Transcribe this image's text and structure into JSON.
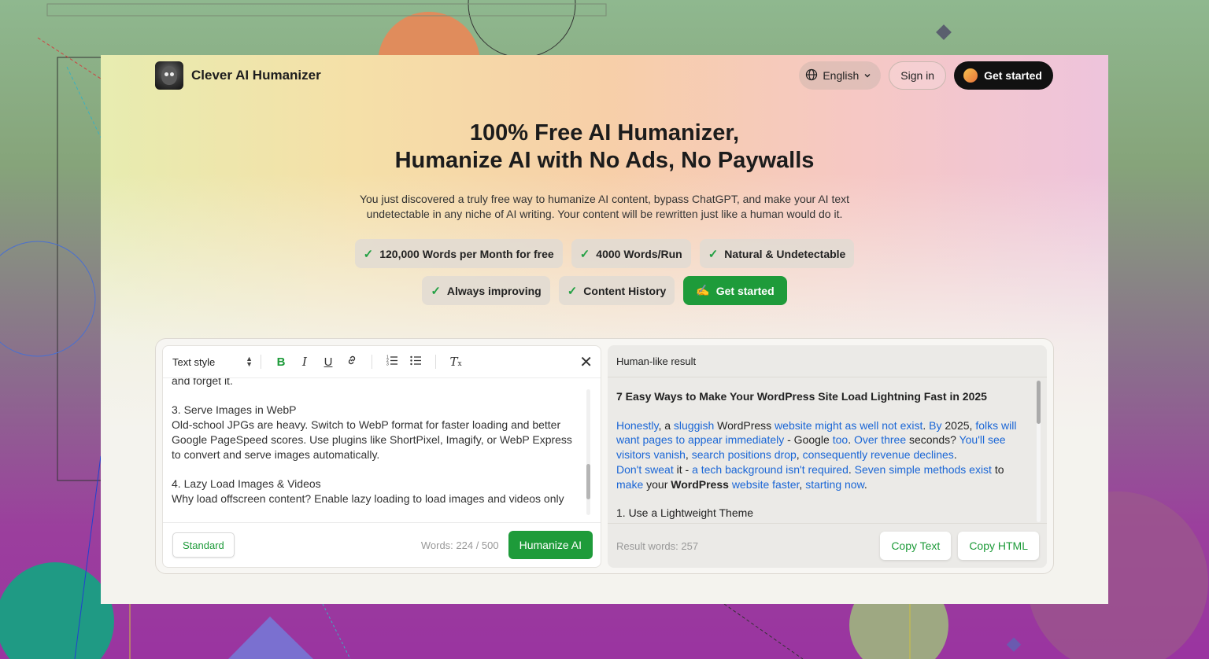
{
  "header": {
    "brand": "Clever AI Humanizer",
    "language": "English",
    "sign_in": "Sign in",
    "get_started": "Get started"
  },
  "hero": {
    "title_line1": "100% Free AI Humanizer,",
    "title_line2": "Humanize AI with No Ads, No Paywalls",
    "subtitle": "You just discovered a truly free way to humanize AI content, bypass ChatGPT, and make your AI text undetectable in any niche of AI writing. Your content will be rewritten just like a human would do it."
  },
  "features": {
    "row1": [
      "120,000 Words per Month for free",
      "4000 Words/Run",
      "Natural & Undetectable"
    ],
    "row2": [
      "Always improving",
      "Content History"
    ],
    "cta": "Get started"
  },
  "editor": {
    "text_style": "Text style",
    "content": "and forget it.\n\n3. Serve Images in WebP\nOld-school JPGs are heavy. Switch to WebP format for faster loading and better Google PageSpeed scores. Use plugins like ShortPixel, Imagify, or WebP Express to convert and serve images automatically.\n\n4. Lazy Load Images & Videos\nWhy load offscreen content? Enable lazy loading to load images and videos only",
    "mode": "Standard",
    "word_count": "Words: 224 / 500",
    "humanize": "Humanize AI"
  },
  "result": {
    "header": "Human-like result",
    "title": "7 Easy Ways to Make Your WordPress Site Load Lightning Fast in 2025",
    "p1": [
      {
        "t": "Honestly",
        "b": true
      },
      {
        "t": ", a ",
        "b": false
      },
      {
        "t": "sluggish",
        "b": true
      },
      {
        "t": " WordPress ",
        "b": false
      },
      {
        "t": "website might as well not exist",
        "b": true
      },
      {
        "t": ". ",
        "b": false
      },
      {
        "t": "By",
        "b": true
      },
      {
        "t": " 2025, ",
        "b": false
      },
      {
        "t": "folks will want pages to appear immediately",
        "b": true
      },
      {
        "t": " - Google ",
        "b": false
      },
      {
        "t": "too",
        "b": true
      },
      {
        "t": ". ",
        "b": false
      },
      {
        "t": "Over three",
        "b": true
      },
      {
        "t": " seconds? ",
        "b": false
      },
      {
        "t": "You'll see visitors vanish",
        "b": true
      },
      {
        "t": ", ",
        "b": false
      },
      {
        "t": "search positions drop",
        "b": true
      },
      {
        "t": ", ",
        "b": false
      },
      {
        "t": "consequently revenue declines",
        "b": true
      },
      {
        "t": ".",
        "b": false
      }
    ],
    "p2": [
      {
        "t": "Don't sweat",
        "b": true
      },
      {
        "t": " it - ",
        "b": false
      },
      {
        "t": "a tech background isn't required",
        "b": true
      },
      {
        "t": ". ",
        "b": false
      },
      {
        "t": "Seven simple methods exist",
        "b": true
      },
      {
        "t": " to ",
        "b": false
      },
      {
        "t": "make",
        "b": true
      },
      {
        "t": " your ",
        "b": false
      },
      {
        "t": "WordPress",
        "b": false,
        "strong": true
      },
      {
        "t": " ",
        "b": false
      },
      {
        "t": "website faster",
        "b": true
      },
      {
        "t": ", ",
        "b": false
      },
      {
        "t": "starting now",
        "b": true
      },
      {
        "t": ".",
        "b": false
      }
    ],
    "section": "1. Use a Lightweight Theme",
    "word_count": "Result words: 257",
    "copy_text": "Copy Text",
    "copy_html": "Copy HTML"
  },
  "colors": {
    "accent": "#1e9b3a",
    "link": "#1a66d6",
    "dark_button": "#111111"
  }
}
